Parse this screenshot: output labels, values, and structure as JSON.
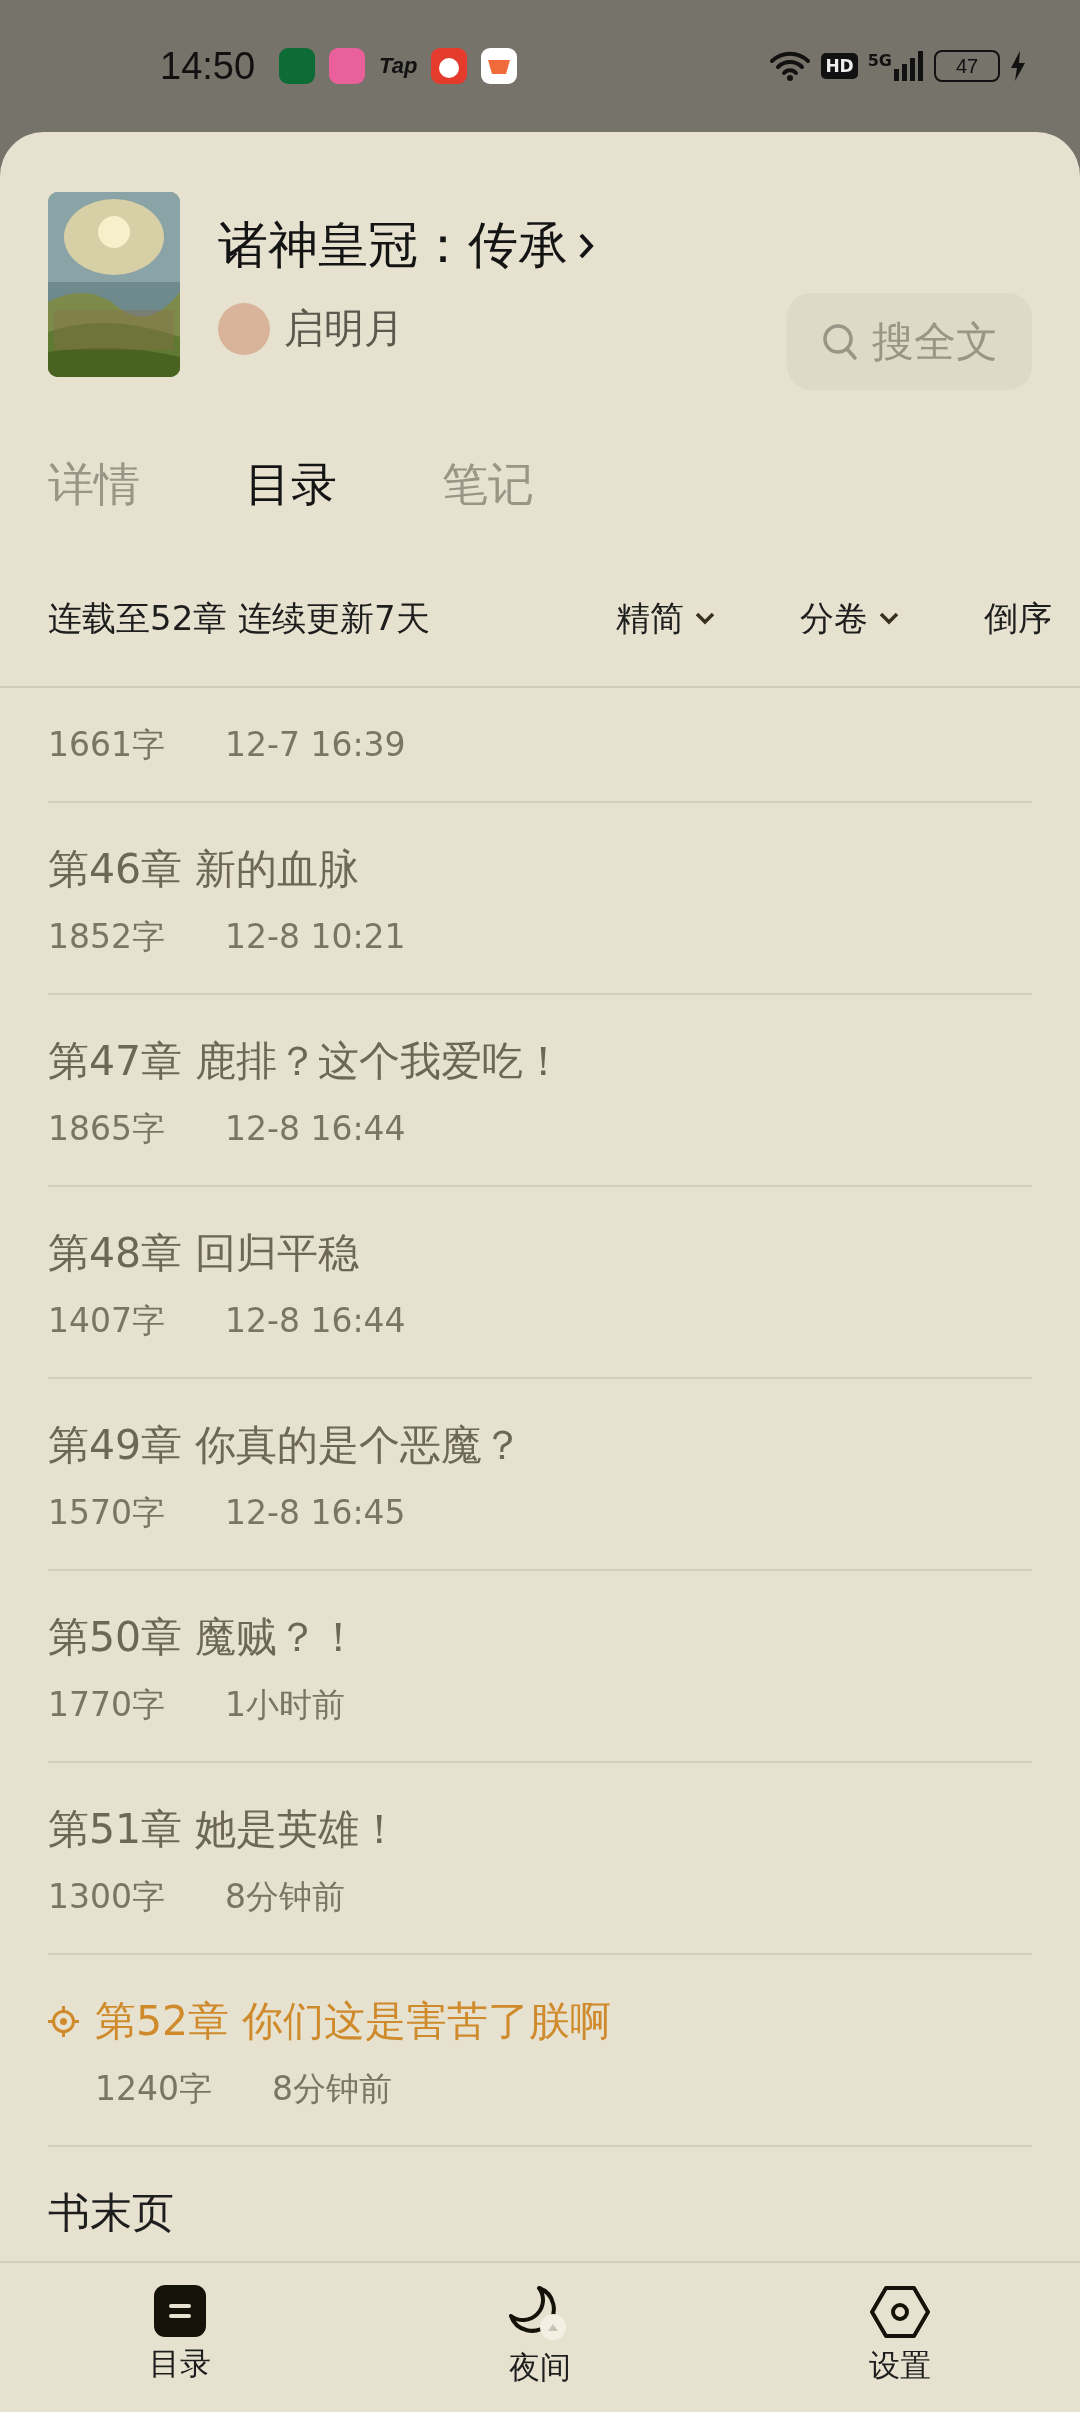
{
  "status_bar": {
    "time": "14:50",
    "app_labels": [
      "Tap"
    ],
    "hd": "HD",
    "network": "5G",
    "battery": "47"
  },
  "book": {
    "title": "诸神皇冠：传承",
    "author": "启明月"
  },
  "search": {
    "label": "搜全文"
  },
  "tabs": [
    {
      "label": "详情",
      "selected": false
    },
    {
      "label": "目录",
      "selected": true
    },
    {
      "label": "笔记",
      "selected": false
    }
  ],
  "filter_bar": {
    "summary": "连载至52章 连续更新7天",
    "controls": [
      {
        "label": "精简",
        "kind": "dropdown"
      },
      {
        "label": "分卷",
        "kind": "dropdown"
      },
      {
        "label": "倒序",
        "kind": "button"
      }
    ]
  },
  "chapters": [
    {
      "words": "1661字",
      "time": "12-7 16:39",
      "current": false
    },
    {
      "title": "第46章 新的血脉",
      "words": "1852字",
      "time": "12-8 10:21",
      "current": false
    },
    {
      "title": "第47章 鹿排？这个我爱吃！",
      "words": "1865字",
      "time": "12-8 16:44",
      "current": false
    },
    {
      "title": "第48章 回归平稳",
      "words": "1407字",
      "time": "12-8 16:44",
      "current": false
    },
    {
      "title": "第49章 你真的是个恶魔？",
      "words": "1570字",
      "time": "12-8 16:45",
      "current": false
    },
    {
      "title": "第50章 魔贼？！",
      "words": "1770字",
      "time": "1小时前",
      "current": false
    },
    {
      "title": "第51章 她是英雄！",
      "words": "1300字",
      "time": "8分钟前",
      "current": false
    },
    {
      "title": "第52章 你们这是害苦了朕啊",
      "words": "1240字",
      "time": "8分钟前",
      "current": true
    }
  ],
  "end_page": "书末页",
  "bottom_nav": [
    {
      "label": "目录",
      "kind": "contents"
    },
    {
      "label": "夜间",
      "kind": "night"
    },
    {
      "label": "设置",
      "kind": "settings"
    }
  ]
}
